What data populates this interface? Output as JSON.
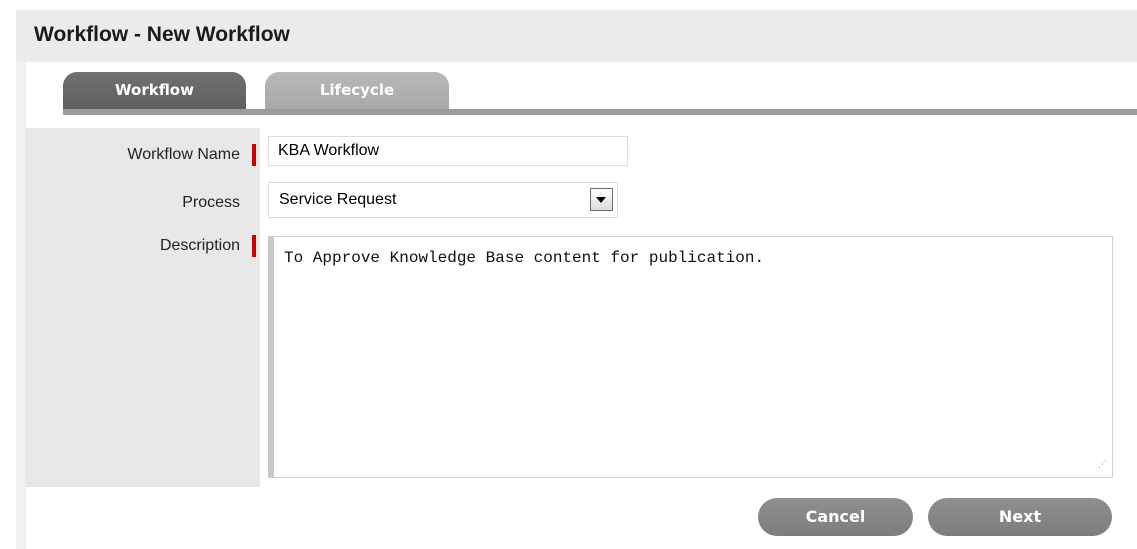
{
  "header": {
    "title": "Workflow - New Workflow"
  },
  "tabs": [
    {
      "label": "Workflow",
      "active": true
    },
    {
      "label": "Lifecycle",
      "active": false
    }
  ],
  "form": {
    "workflow_name": {
      "label": "Workflow Name",
      "value": "KBA Workflow",
      "required": true
    },
    "process": {
      "label": "Process",
      "value": "Service Request",
      "required": false
    },
    "description": {
      "label": "Description",
      "value": "To Approve Knowledge Base content for publication.",
      "required": true
    }
  },
  "buttons": {
    "cancel": "Cancel",
    "next": "Next"
  },
  "colors": {
    "required_marker": "#cc0000",
    "tab_active": "#666666",
    "tab_inactive": "#b0b0b0",
    "button": "#858585"
  }
}
